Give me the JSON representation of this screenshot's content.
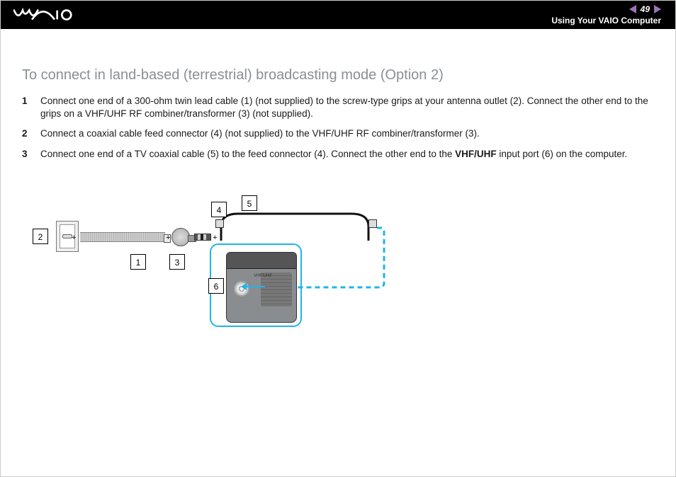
{
  "header": {
    "page_number": "49",
    "section": "Using Your VAIO Computer"
  },
  "page": {
    "title": "To connect in land-based (terrestrial) broadcasting mode (Option 2)",
    "steps": [
      {
        "n": "1",
        "text_a": "Connect one end of a 300-ohm twin lead cable (1) (not supplied) to the screw-type grips at your antenna outlet (2). Connect the other end to the grips on a VHF/UHF RF combiner/transformer (3) (not supplied)."
      },
      {
        "n": "2",
        "text_a": "Connect a coaxial cable feed connector (4) (not supplied) to the VHF/UHF RF combiner/transformer (3)."
      },
      {
        "n": "3",
        "text_a": "Connect one end of a TV coaxial cable (5) to the feed connector (4). Connect the other end to the ",
        "bold": "VHF/UHF",
        "text_b": " input port (6) on the computer."
      }
    ]
  },
  "diagram": {
    "labels": {
      "1": "1",
      "2": "2",
      "3": "3",
      "4": "4",
      "5": "5",
      "6": "6"
    },
    "port_label": "VHF/UHF"
  }
}
